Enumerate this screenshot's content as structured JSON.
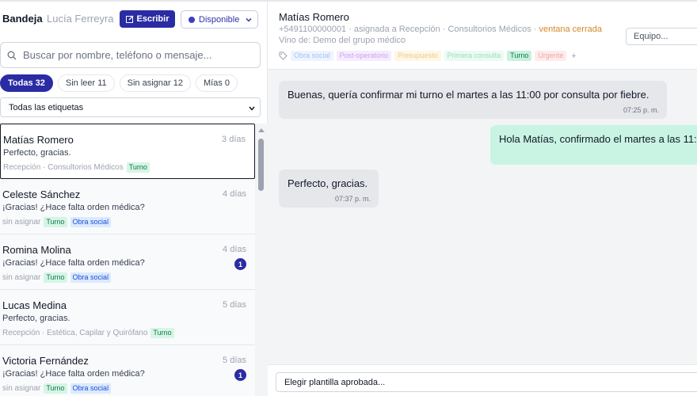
{
  "header": {
    "brand": "Bandeja",
    "agent_name": "Lucía Ferreyra",
    "write_label": "Escribir",
    "status_label": "Disponible"
  },
  "search": {
    "placeholder": "Buscar por nombre, teléfono o mensaje..."
  },
  "filters": [
    {
      "label": "Todas 32",
      "active": true
    },
    {
      "label": "Sin leer 11",
      "active": false
    },
    {
      "label": "Sin asignar 12",
      "active": false
    },
    {
      "label": "Mías 0",
      "active": false
    }
  ],
  "tag_filter": {
    "selected": "Todas las etiquetas"
  },
  "conversations": [
    {
      "name": "Matías Romero",
      "time": "3 días",
      "preview": "Perfecto, gracias.",
      "meta": "Recepción · Consultorios Médicos",
      "tags": [
        "Turno"
      ],
      "unread": "",
      "selected": true
    },
    {
      "name": "Celeste Sánchez",
      "time": "4 días",
      "preview": "¡Gracias! ¿Hace falta orden médica?",
      "meta": "sin asignar",
      "tags": [
        "Turno",
        "Obra social"
      ],
      "unread": ""
    },
    {
      "name": "Romina Molina",
      "time": "4 días",
      "preview": "¡Gracias! ¿Hace falta orden médica?",
      "meta": "sin asignar",
      "tags": [
        "Turno",
        "Obra social"
      ],
      "unread": "1"
    },
    {
      "name": "Lucas Medina",
      "time": "5 días",
      "preview": "Perfecto, gracias.",
      "meta": "Recepción · Estética, Capilar y Quirófano",
      "tags": [
        "Turno"
      ],
      "unread": ""
    },
    {
      "name": "Victoria Fernández",
      "time": "5 días",
      "preview": "¡Gracias! ¿Hace falta orden médica?",
      "meta": "sin asignar",
      "tags": [
        "Turno",
        "Obra social"
      ],
      "unread": "1"
    }
  ],
  "chat": {
    "name": "Matías Romero",
    "phone": "+5491100000001",
    "assignment": " · asignada a Recepción · Consultorios Médicos · ",
    "window_status": "ventana cerrada",
    "source": "Vino de: Demo del grupo médico",
    "team_placeholder": "Equipo...",
    "tags": [
      {
        "label": "Obra social",
        "style": "t-obra"
      },
      {
        "label": "Post-operatorio",
        "style": "t-post"
      },
      {
        "label": "Presupuesto",
        "style": "t-presu"
      },
      {
        "label": "Primera consulta",
        "style": "t-primera"
      },
      {
        "label": "Turno",
        "style": "t-turno"
      },
      {
        "label": "Urgente",
        "style": "t-urg"
      }
    ],
    "add_tag": "+",
    "messages": [
      {
        "direction": "in",
        "text": "Buenas, quería confirmar mi turno el martes a las 11:00 por consulta por fiebre.",
        "time": "07:25 p. m."
      },
      {
        "direction": "out",
        "text": "Hola Matías, confirmado el martes a las 11:",
        "time": ""
      },
      {
        "direction": "in",
        "text": "Perfecto, gracias.",
        "time": "07:37 p. m."
      }
    ],
    "template_placeholder": "Elegir plantilla aprobada..."
  },
  "colors": {
    "accent": "#2a2ca4",
    "turno_tag": "#d6f5e6",
    "obra_tag": "#dbeafe",
    "outgoing_bubble": "#c9f4e3",
    "warning": "#d4882c"
  }
}
